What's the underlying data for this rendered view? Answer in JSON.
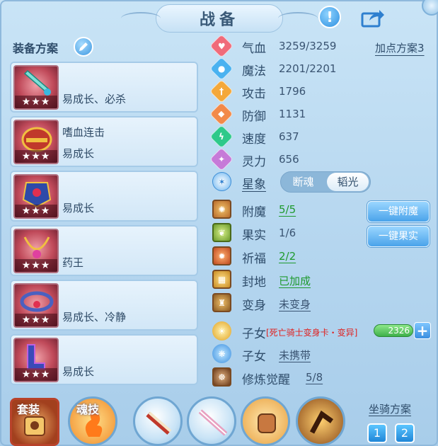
{
  "title": "战备",
  "equipment": {
    "heading": "装备方案",
    "items": [
      {
        "line1": "",
        "line2": "易成长、必杀",
        "stars": "★★★"
      },
      {
        "line1": "嗜血连击",
        "line2": "易成长",
        "stars": "★★★"
      },
      {
        "line1": "",
        "line2": "易成长",
        "stars": "★★★"
      },
      {
        "line1": "",
        "line2": "药王",
        "stars": "★★★"
      },
      {
        "line1": "",
        "line2": "易成长、冷静",
        "stars": "★★★"
      },
      {
        "line1": "",
        "line2": "易成长",
        "stars": "★★★"
      }
    ]
  },
  "stats": {
    "scheme_link": "加点方案3",
    "rows": [
      {
        "label": "气血",
        "value": "3259/3259",
        "icon": "heart-icon",
        "color": "#f06b7a"
      },
      {
        "label": "魔法",
        "value": "2201/2201",
        "icon": "mana-icon",
        "color": "#4ab2f0"
      },
      {
        "label": "攻击",
        "value": "1796",
        "icon": "sword-icon",
        "color": "#f4a83a"
      },
      {
        "label": "防御",
        "value": "1131",
        "icon": "shield-icon",
        "color": "#f28a4a"
      },
      {
        "label": "速度",
        "value": "637",
        "icon": "speed-icon",
        "color": "#2ec98a"
      },
      {
        "label": "灵力",
        "value": "656",
        "icon": "spirit-icon",
        "color": "#c67ad8"
      }
    ],
    "star": {
      "label": "星象",
      "options": [
        "断魂",
        "韬光"
      ],
      "active": 1
    }
  },
  "extras": [
    {
      "label": "附魔",
      "value": "5/5",
      "value_color": "green"
    },
    {
      "label": "果实",
      "value": "1/6",
      "value_color": "normal"
    },
    {
      "label": "祈福",
      "value": "2/2",
      "value_color": "green"
    },
    {
      "label": "封地",
      "value": "已加成",
      "value_color": "green"
    },
    {
      "label": "变身",
      "value": "未变身",
      "value_color": "normal"
    }
  ],
  "buttons": {
    "enchant": "一键附魔",
    "fruit": "一键果实"
  },
  "children": [
    {
      "label": "子女",
      "value": "[死亡骑士变身卡・变异]",
      "bar_value": "2326"
    },
    {
      "label": "子女",
      "value": "未携带"
    }
  ],
  "cultivation": {
    "label": "修炼觉醒",
    "value": "5/8"
  },
  "bottom": {
    "suit_label": "套装",
    "soul_label": "魂技",
    "mount_title": "坐骑方案",
    "mount_buttons": [
      "1",
      "2"
    ]
  },
  "colors": {
    "accent": "#3b8fe0",
    "green": "#1f9a2e",
    "red": "#e0201f"
  }
}
